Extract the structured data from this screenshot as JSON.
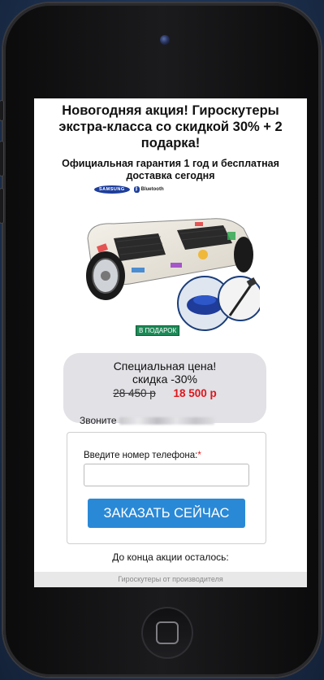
{
  "page": {
    "headline": "Новогодняя акция! Гироскутеры экстра-класса со скидкой 30% + 2 подарка!",
    "subheadline": "Официальная гарантия 1 год и бесплатная доставка сегодня",
    "brands": {
      "samsung": "SAMSUNG",
      "bluetooth": "Bluetooth"
    },
    "gift_badge": "В ПОДАРОК",
    "offer": {
      "line1": "Специальная цена!",
      "line2": "скидка -30%",
      "old_price": "28 450 р",
      "new_price": "18 500 р",
      "call_label": "Звоните"
    },
    "form": {
      "phone_label": "Введите номер телефона:",
      "required_mark": "*",
      "phone_value": "",
      "submit_label": "ЗАКАЗАТЬ СЕЙЧАС"
    },
    "countdown_label": "До конца акции осталось:",
    "footer_text": "Гироскутеры от производителя"
  },
  "colors": {
    "accent_button": "#2a89d7",
    "price_red": "#e0151b",
    "gift_green": "#1c8a57",
    "background": "#1f3557"
  },
  "icons": [
    "samsung-logo",
    "bluetooth-icon",
    "hoverboard-image",
    "gift-bag-image",
    "selfie-stick-image",
    "home-button-icon",
    "front-camera-icon"
  ]
}
